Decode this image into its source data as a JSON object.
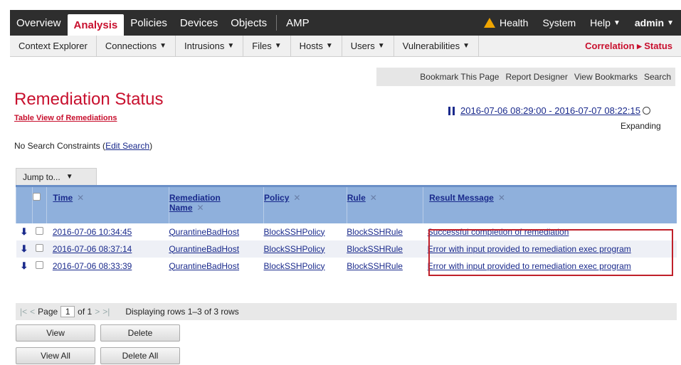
{
  "topnav": {
    "items": [
      "Overview",
      "Analysis",
      "Policies",
      "Devices",
      "Objects",
      "AMP"
    ],
    "right": {
      "health": "Health",
      "system": "System",
      "help": "Help",
      "user": "admin"
    }
  },
  "subnav": {
    "items": [
      "Context Explorer",
      "Connections",
      "Intrusions",
      "Files",
      "Hosts",
      "Users",
      "Vulnerabilities"
    ],
    "active": "Correlation ▸ Status"
  },
  "bookmarks": [
    "Bookmark This Page",
    "Report Designer",
    "View Bookmarks",
    "Search"
  ],
  "page": {
    "title": "Remediation Status",
    "table_view": "Table View of Remediations",
    "time_range": "2016-07-06 08:29:00 - 2016-07-07 08:22:15",
    "expanding": "Expanding",
    "constraints_prefix": "No Search Constraints (",
    "edit_search": "Edit Search",
    "constraints_suffix": ")",
    "jump": "Jump to..."
  },
  "table": {
    "headers": {
      "time": "Time",
      "remediation_name_1": "Remediation",
      "remediation_name_2": "Name",
      "policy": "Policy",
      "rule": "Rule",
      "result": "Result Message"
    },
    "rows": [
      {
        "time": "2016-07-06 10:34:45",
        "name": "QurantineBadHost",
        "policy": "BlockSSHPolicy",
        "rule": "BlockSSHRule",
        "result": "Successful completion of remediation"
      },
      {
        "time": "2016-07-06 08:37:14",
        "name": "QurantineBadHost",
        "policy": "BlockSSHPolicy",
        "rule": "BlockSSHRule",
        "result": "Error with input provided to remediation exec program"
      },
      {
        "time": "2016-07-06 08:33:39",
        "name": "QurantineBadHost",
        "policy": "BlockSSHPolicy",
        "rule": "BlockSSHRule",
        "result": "Error with input provided to remediation exec program"
      }
    ]
  },
  "pager": {
    "page_label": "Page",
    "page": "1",
    "of": "of 1",
    "display": "Displaying rows 1–3 of 3 rows"
  },
  "buttons": {
    "view": "View",
    "delete": "Delete",
    "view_all": "View All",
    "delete_all": "Delete All"
  }
}
